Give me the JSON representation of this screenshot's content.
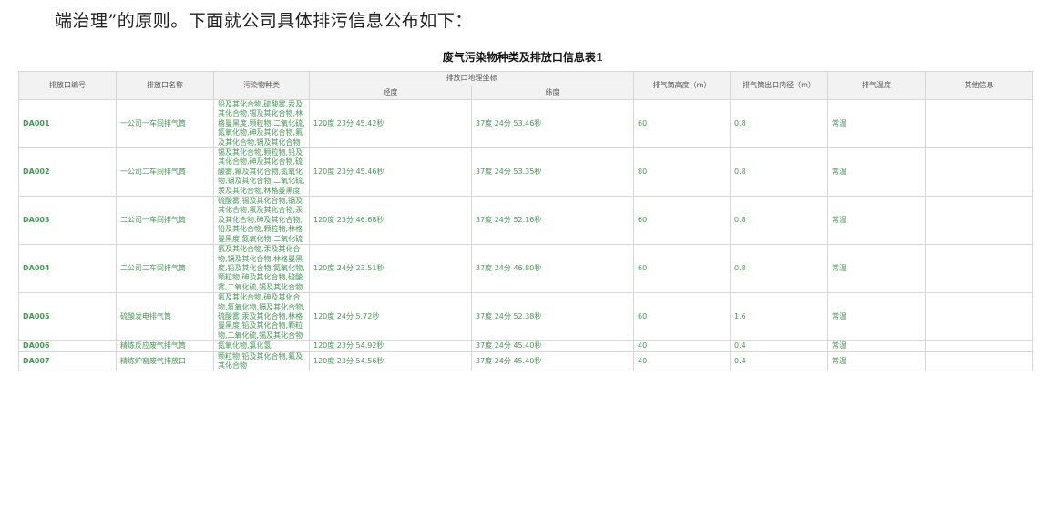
{
  "intro_text": "端治理”的原则。下面就公司具体排污信息公布如下：",
  "table_title": "废气污染物种类及排放口信息表1",
  "headers": {
    "code": "排放口编号",
    "name": "排放口名称",
    "pollutants": "污染物种类",
    "coords": "排放口地理坐标",
    "longitude": "经度",
    "latitude": "纬度",
    "height": "排气筒高度（m）",
    "diameter": "排气筒出口内径（m）",
    "temp": "排气温度",
    "other": "其他信息"
  },
  "rows": [
    {
      "code": "DA001",
      "name": "一公司一车间排气筒",
      "pollutants": "铅及其化合物,硫酸雾,汞及其化合物,锡及其化合物,林格曼黑度,颗粒物,二氧化硫,氮氧化物,砷及其化合物,氟及其化合物,镉及其化合物",
      "lon": "120度 23分 45.42秒",
      "lat": "37度 24分 53.46秒",
      "height": "60",
      "diameter": "0.8",
      "temp": "常温",
      "other": ""
    },
    {
      "code": "DA002",
      "name": "一公司二车间排气筒",
      "pollutants": "锡及其化合物,颗粒物,铅及其化合物,砷及其化合物,硫酸雾,氟及其化合物,氮氧化物,镉及其化合物,二氧化硫,汞及其化合物,林格曼黑度",
      "lon": "120度 23分 45.46秒",
      "lat": "37度 24分 53.35秒",
      "height": "80",
      "diameter": "0.8",
      "temp": "常温",
      "other": ""
    },
    {
      "code": "DA003",
      "name": "二公司一车间排气筒",
      "pollutants": "硫酸雾,锡及其化合物,镉及其化合物,氟及其化合物,汞及其化合物,砷及其化合物,铅及其化合物,颗粒物,林格曼黑度,氮氧化物,二氧化硫",
      "lon": "120度 23分 46.68秒",
      "lat": "37度 24分 52.16秒",
      "height": "60",
      "diameter": "0.8",
      "temp": "常温",
      "other": ""
    },
    {
      "code": "DA004",
      "name": "二公司二车间排气筒",
      "pollutants": "氟及其化合物,汞及其化合物,镉及其化合物,林格曼黑度,铅及其化合物,氮氧化物,颗粒物,砷及其化合物,硫酸雾,二氧化硫,锡及其化合物",
      "lon": "120度 24分 23.51秒",
      "lat": "37度 24分 46.80秒",
      "height": "60",
      "diameter": "0.8",
      "temp": "常温",
      "other": ""
    },
    {
      "code": "DA005",
      "name": "硫酸发电排气筒",
      "pollutants": "氟及其化合物,砷及其化合物,氮氧化物,镉及其化合物,硫酸雾,汞及其化合物,林格曼黑度,铅及其化合物,颗粒物,二氧化硫,锡及其化合物",
      "lon": "120度 24分 5.72秒",
      "lat": "37度 24分 52.38秒",
      "height": "60",
      "diameter": "1.6",
      "temp": "常温",
      "other": ""
    },
    {
      "code": "DA006",
      "name": "精炼反应废气排气筒",
      "pollutants": "氮氧化物,氯化氢",
      "lon": "120度 23分 54.92秒",
      "lat": "37度 24分 45.40秒",
      "height": "40",
      "diameter": "0.4",
      "temp": "常温",
      "other": ""
    },
    {
      "code": "DA007",
      "name": "精炼炉窑废气排放口",
      "pollutants": "颗粒物,铅及其化合物,氟及其化合物",
      "lon": "120度 23分 54.56秒",
      "lat": "37度 24分 45.40秒",
      "height": "40",
      "diameter": "0.4",
      "temp": "常温",
      "other": ""
    }
  ]
}
